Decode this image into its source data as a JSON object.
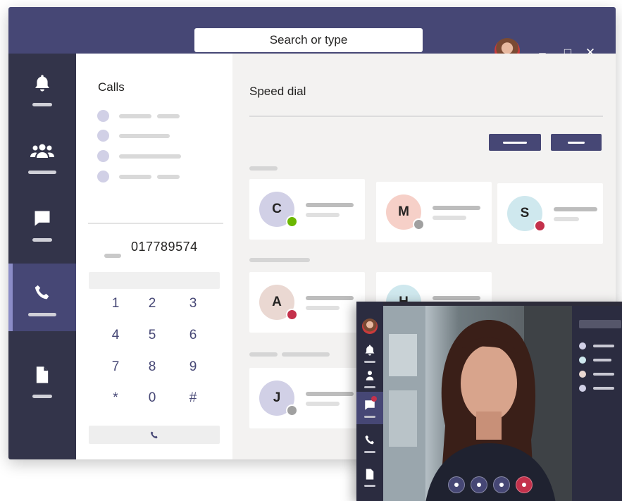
{
  "window": {
    "search_placeholder": "Search or type",
    "controls": [
      "minimize-icon",
      "maximize-icon",
      "close-icon"
    ]
  },
  "rail": {
    "items": [
      {
        "icon": "bell-icon",
        "active": false
      },
      {
        "icon": "people-icon",
        "active": false
      },
      {
        "icon": "chat-icon",
        "active": false
      },
      {
        "icon": "phone-icon",
        "active": true
      },
      {
        "icon": "file-icon",
        "active": false
      }
    ]
  },
  "calls": {
    "title": "Calls",
    "dial_number": "017789574",
    "keypad": [
      "1",
      "2",
      "3",
      "4",
      "5",
      "6",
      "7",
      "8",
      "9",
      "*",
      "0",
      "#"
    ]
  },
  "speed_dial": {
    "title": "Speed dial",
    "contacts": [
      {
        "initial": "C",
        "avatar_color": "#d1d0e6",
        "presence": "available",
        "presence_color": "#6bb700"
      },
      {
        "initial": "M",
        "avatar_color": "#f6d0c8",
        "presence": "offline",
        "presence_color": "#a0a0a0"
      },
      {
        "initial": "S",
        "avatar_color": "#cfe8ee",
        "presence": "busy",
        "presence_color": "#c4314b"
      },
      {
        "initial": "A",
        "avatar_color": "#ead8d2",
        "presence": "busy",
        "presence_color": "#c4314b"
      },
      {
        "initial": "H",
        "avatar_color": "#cfe8ee",
        "presence": "available",
        "presence_color": "#6bb700"
      },
      {
        "initial": "J",
        "avatar_color": "#d1d0e6",
        "presence": "offline",
        "presence_color": "#a0a0a0"
      }
    ]
  },
  "video_call": {
    "controls": [
      "camera-button",
      "mic-button",
      "share-button",
      "hang-up-button"
    ]
  },
  "colors": {
    "brand": "#464775",
    "rail": "#33344a",
    "hangup": "#c4314b"
  }
}
